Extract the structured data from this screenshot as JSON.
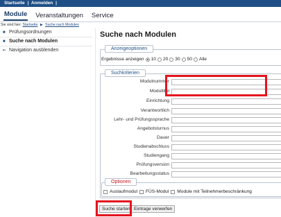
{
  "topbar": {
    "home": "Startseite",
    "sep": "|",
    "login": "Anmelden",
    "sep2": "|"
  },
  "tabs": [
    {
      "label": "Module"
    },
    {
      "label": "Veranstaltungen"
    },
    {
      "label": "Service"
    }
  ],
  "breadcrumb": {
    "prefix": "Sie sind hier:",
    "home": "Startseite",
    "separator": "▶",
    "current": "Suche nach Modulen"
  },
  "sidebar": {
    "items": [
      {
        "label": "Prüfungsordnungen"
      },
      {
        "label": "Suche nach Modulen"
      },
      {
        "label": "Navigation ausblenden"
      }
    ]
  },
  "page": {
    "title": "Suche nach Modulen"
  },
  "display_options": {
    "legend": "Anzeigeoptionen",
    "results_label": "Ergebnisse anzeigen",
    "choices": [
      "10",
      "20",
      "30",
      "50",
      "Alle"
    ],
    "selected": "10"
  },
  "criteria": {
    "legend": "Suchkriterien",
    "fields": [
      "Modulnummer",
      "Modultitel",
      "Einrichtung",
      "Verantwortlich",
      "Lehr- und Prüfungssprache",
      "Angebotsturnus",
      "Dauer",
      "Studienabschluss",
      "Studiengang",
      "Prüfungsversion",
      "Bearbeitungsstatus"
    ]
  },
  "options": {
    "legend": "Optionen",
    "checks": [
      "Auslaufmodul",
      "FÜS-Modul",
      "Module mit Teilnehmerbeschränkung"
    ]
  },
  "buttons": {
    "search": "Suche starten",
    "reset": "Eintrage verwerfen"
  },
  "colors": {
    "header_bg": "#1f4f86",
    "highlight": "#e3131e",
    "legend_text": "#1f4f86"
  }
}
